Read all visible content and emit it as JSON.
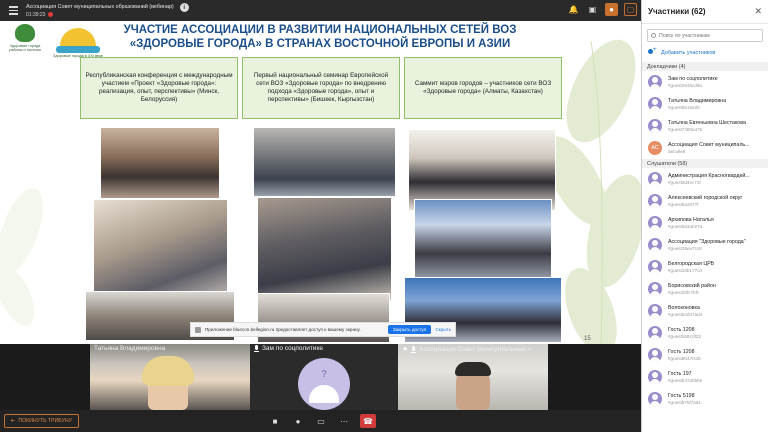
{
  "window": {
    "title": "Ассоциация Совет муниципальных образований (вебинар)",
    "timer": "01:39:23"
  },
  "slide": {
    "title_line1": "Участие Ассоциации в развитии национальных сетей ВОЗ",
    "title_line2": "«Здоровые города» в странах Восточной Европы и Азии",
    "logo1_caption": "Здоровые города районы и поселки",
    "logo2_caption": "Здоровые города в XXI веке",
    "cards": [
      "Республиканская конференция с международным участием «Проект «Здоровые города»: реализация, опыт, перспективы» (Минск, Белоруссия)",
      "Первый национальный семинар Европейской сети ВОЗ «Здоровые города» по внедрению подхода «Здоровые города», опыт и перспективы» (Бишкек, Кыргызстан)",
      "Саммит мэров городов – участников сети ВОЗ «Здоровые города» (Алматы, Казахстан)"
    ],
    "slide_number": "15"
  },
  "notification": {
    "text": "Приложение bluecon.bellegion.ru предоставляет доступ к вашему экрану.",
    "allow": "Закрыть доступ",
    "hide": "Скрыть"
  },
  "videos": [
    {
      "name": "Татьяна Владимировна"
    },
    {
      "name": "Зам по соцполитике"
    },
    {
      "name": "Ассоциация Совет муниципальных о"
    }
  ],
  "bottom": {
    "leave_label": "ПОКИНУТЬ ТРИБУНУ"
  },
  "panel": {
    "title": "Участники (62)",
    "search_placeholder": "Поиск по участникам",
    "add_users": "Добавить участников",
    "section_speakers": "Докладчики (4)",
    "section_listeners": "Слушатели (58)",
    "speakers": [
      {
        "name": "Зам по соцполитике",
        "sub": "#guest2946cd9a"
      },
      {
        "name": "Татьяна Владимировна",
        "sub": "#guest6515e2b"
      },
      {
        "name": "Татьяна Евгеньевна Шестакова",
        "sub": "#guest7480a475"
      },
      {
        "name": "Ассоциация Совет муниципаль...",
        "sub": "автойей",
        "initials": "АС"
      }
    ],
    "listeners": [
      {
        "name": "Администрация Красногвардей...",
        "sub": "#guest5d4ec71f"
      },
      {
        "name": "Алексеевский городской округ",
        "sub": "#guest6a2077f"
      },
      {
        "name": "Архипова Наталья",
        "sub": "#guest5a3a027a"
      },
      {
        "name": "Ассоциация \"Здоровые города\"",
        "sub": "#guest35ea7cc8"
      },
      {
        "name": "Белгородская ЦРБ",
        "sub": "#guest18b177cd"
      },
      {
        "name": "Борисовский район",
        "sub": "#guest26fc7bfc"
      },
      {
        "name": "Волоконовка",
        "sub": "#guest62d37ad4"
      },
      {
        "name": "Гость 1208",
        "sub": "#guestb5810f23"
      },
      {
        "name": "Гость 1208",
        "sub": "#guest8b47f42b"
      },
      {
        "name": "Гость 197",
        "sub": "#guestb47a0bbe"
      },
      {
        "name": "Гость 5198",
        "sub": "#guestb75f7a61"
      }
    ]
  }
}
